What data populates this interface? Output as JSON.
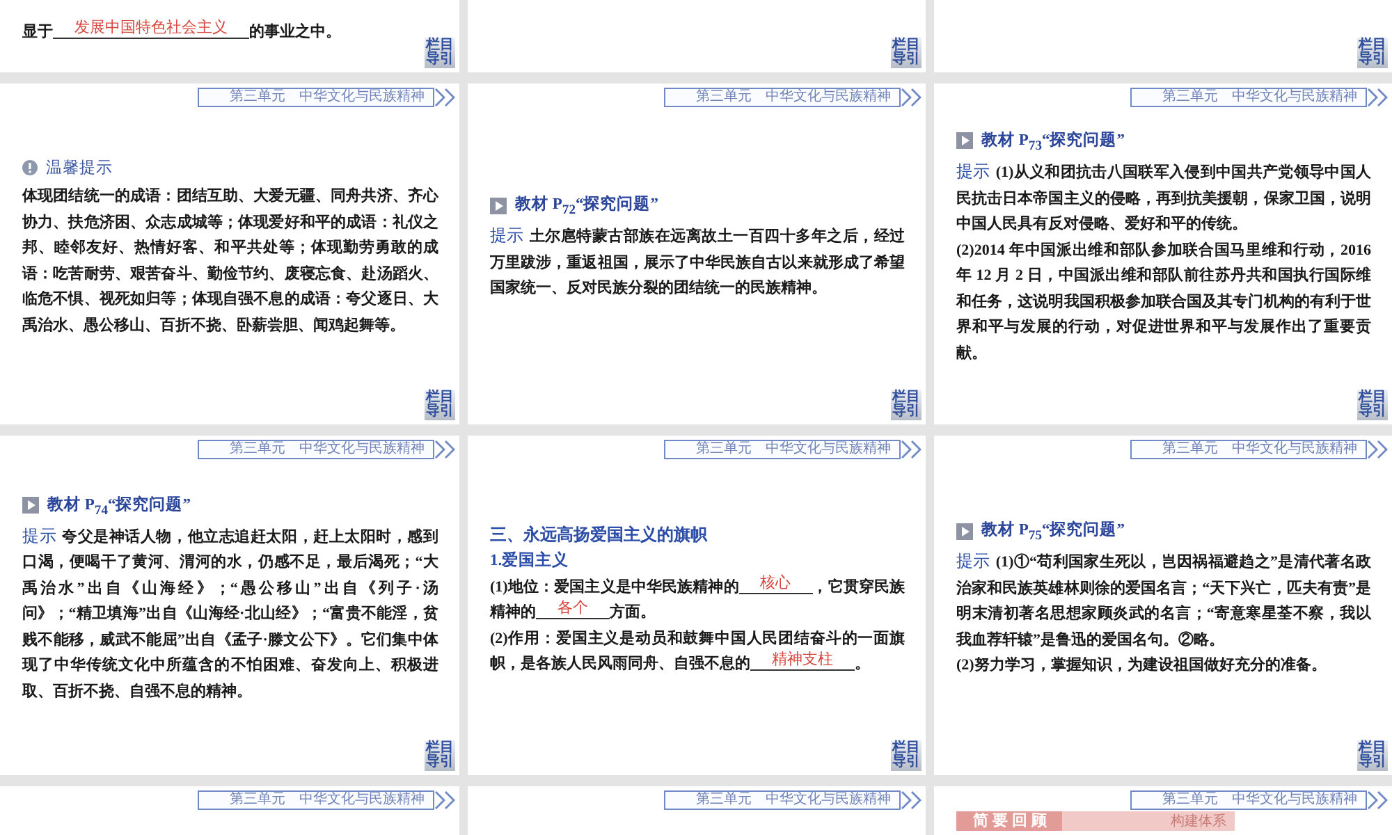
{
  "slides": [
    {
      "blocks": [
        {
          "kind": "fill",
          "parts": [
            {
              "text": "显于"
            },
            {
              "blank": "发展中国特色社会主义"
            },
            {
              "text": "的事业之中。"
            }
          ]
        }
      ],
      "nav": [
        "栏目",
        "导引"
      ]
    },
    {
      "nav": [
        "栏目",
        "导引"
      ]
    },
    {
      "nav": [
        "栏目",
        "导引"
      ]
    },
    {
      "header": {
        "unit": "第三单元",
        "title": "中华文化与民族精神"
      },
      "blocks": [
        {
          "kind": "note_heading",
          "text": "温馨提示"
        },
        {
          "kind": "text",
          "text": "体现团结统一的成语：团结互助、大爱无疆、同舟共济、齐心协力、扶危济困、众志成城等；体现爱好和平的成语：礼仪之邦、睦邻友好、热情好客、和平共处等；体现勤劳勇敢的成语：吃苦耐劳、艰苦奋斗、勤俭节约、废寝忘食、赴汤蹈火、临危不惧、视死如归等；体现自强不息的成语：夸父逐日、大禹治水、愚公移山、百折不挠、卧薪尝胆、闻鸡起舞等。"
        }
      ],
      "nav": [
        "栏目",
        "导引"
      ]
    },
    {
      "header": {
        "unit": "第三单元",
        "title": "中华文化与民族精神"
      },
      "blocks": [
        {
          "kind": "task_heading",
          "text": "教材 P$_{72}$“探究问题”"
        },
        {
          "kind": "hint",
          "label": "提示",
          "text": "土尔扈特蒙古部族在远离故土一百四十多年之后，经过万里跋涉，重返祖国，展示了中华民族自古以来就形成了希望国家统一、反对民族分裂的团结统一的民族精神。"
        }
      ],
      "nav": [
        "栏目",
        "导引"
      ]
    },
    {
      "header": {
        "unit": "第三单元",
        "title": "中华文化与民族精神"
      },
      "blocks": [
        {
          "kind": "task_heading",
          "text": "教材 P$_{73}$“探究问题”"
        },
        {
          "kind": "hint",
          "label": "提示",
          "text": "(1)从义和团抗击八国联军入侵到中国共产党领导中国人民抗击日本帝国主义的侵略，再到抗美援朝，保家卫国，说明中国人民具有反对侵略、爱好和平的传统。"
        },
        {
          "kind": "text",
          "text": "(2)2014 年中国派出维和部队参加联合国马里维和行动，2016 年 12 月 2 日，中国派出维和部队前往苏丹共和国执行国际维和任务，这说明我国积极参加联合国及其专门机构的有利于世界和平与发展的行动，对促进世界和平与发展作出了重要贡献。"
        }
      ],
      "nav": [
        "栏目",
        "导引"
      ]
    },
    {
      "header": {
        "unit": "第三单元",
        "title": "中华文化与民族精神"
      },
      "blocks": [
        {
          "kind": "task_heading",
          "text": "教材 P$_{74}$“探究问题”"
        },
        {
          "kind": "hint",
          "label": "提示",
          "text": "夸父是神话人物，他立志追赶太阳，赶上太阳时，感到口渴，便喝干了黄河、渭河的水，仍感不足，最后渴死；“大禹治水”出自《山海经》；“愚公移山”出自《列子·汤问》；“精卫填海”出自《山海经·北山经》；“富贵不能淫，贫贱不能移，威武不能屈”出自《孟子·滕文公下》。它们集中体现了中华传统文化中所蕴含的不怕困难、奋发向上、积极进取、百折不挠、自强不息的精神。"
        }
      ],
      "nav": [
        "栏目",
        "导引"
      ]
    },
    {
      "header": {
        "unit": "第三单元",
        "title": "中华文化与民族精神"
      },
      "blocks": [
        {
          "kind": "section_title",
          "text": "三、永远高扬爱国主义的旗帜"
        },
        {
          "kind": "subtitle",
          "text": "1.爱国主义"
        },
        {
          "kind": "fill",
          "parts": [
            {
              "text": "(1)地位：爱国主义是中华民族精神的"
            },
            {
              "blank": "核心"
            },
            {
              "text": "，它贯穿民族精神的"
            },
            {
              "blank": "各个"
            },
            {
              "text": "方面。"
            }
          ]
        },
        {
          "kind": "fill",
          "parts": [
            {
              "text": "(2)作用：爱国主义是动员和鼓舞中国人民团结奋斗的一面旗帜，是各族人民风雨同舟、自强不息的"
            },
            {
              "blank": "精神支柱"
            },
            {
              "text": "。"
            }
          ]
        }
      ],
      "nav": [
        "栏目",
        "导引"
      ]
    },
    {
      "header": {
        "unit": "第三单元",
        "title": "中华文化与民族精神"
      },
      "blocks": [
        {
          "kind": "task_heading",
          "text": "教材 P$_{75}$“探究问题”"
        },
        {
          "kind": "hint",
          "label": "提示",
          "text": "(1)①“苟利国家生死以，岂因祸福避趋之”是清代著名政治家和民族英雄林则徐的爱国名言；“天下兴亡，匹夫有责”是明末清初著名思想家顾炎武的名言；“寄意寒星荃不察，我以我血荐轩辕”是鲁迅的爱国名句。②略。"
        },
        {
          "kind": "text",
          "text": "(2)努力学习，掌握知识，为建设祖国做好充分的准备。"
        }
      ],
      "nav": [
        "栏目",
        "导引"
      ]
    },
    {
      "header": {
        "unit": "第三单元",
        "title": "中华文化与民族精神"
      }
    },
    {
      "header": {
        "unit": "第三单元",
        "title": "中华文化与民族精神"
      }
    },
    {
      "header": {
        "unit": "第三单元",
        "title": "中华文化与民族精神"
      },
      "blocks": [
        {
          "kind": "review",
          "label": "简要回顾",
          "tag": "构建体系"
        }
      ]
    }
  ]
}
